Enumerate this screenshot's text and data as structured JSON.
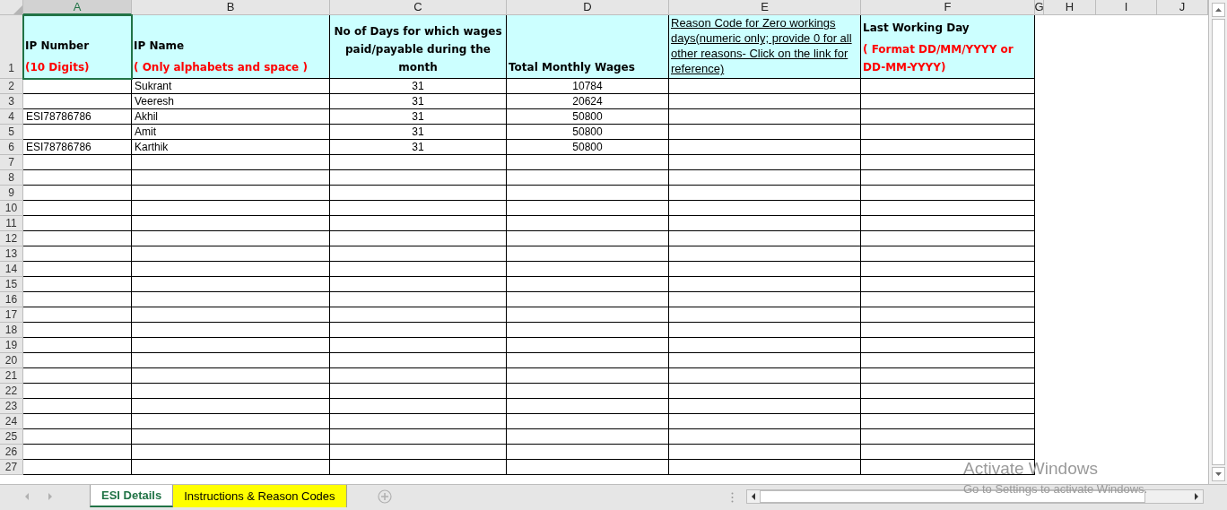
{
  "column_headers": [
    {
      "label": "A",
      "selected": true
    },
    {
      "label": "B",
      "selected": false
    },
    {
      "label": "C",
      "selected": false
    },
    {
      "label": "D",
      "selected": false
    },
    {
      "label": "E",
      "selected": false
    },
    {
      "label": "F",
      "selected": false
    },
    {
      "label": "G",
      "selected": false
    },
    {
      "label": "H",
      "selected": false
    },
    {
      "label": "I",
      "selected": false
    },
    {
      "label": "J",
      "selected": false
    }
  ],
  "row_numbers": [
    "1",
    "2",
    "3",
    "4",
    "5",
    "6",
    "7",
    "8",
    "9",
    "10",
    "11",
    "12",
    "13",
    "14",
    "15",
    "16",
    "17",
    "18",
    "19",
    "20",
    "21",
    "22",
    "23",
    "24",
    "25",
    "26",
    "27"
  ],
  "header_cells": [
    {
      "kind": "label",
      "title": "IP Number",
      "note": "(10 Digits)",
      "selected": true
    },
    {
      "kind": "label",
      "title": "IP Name",
      "note": "( Only alphabets and space )",
      "selected": false
    },
    {
      "kind": "label",
      "title": "No of Days for which wages paid/payable during the month",
      "selected": false
    },
    {
      "kind": "label",
      "title": "Total Monthly Wages",
      "selected": false
    },
    {
      "kind": "link",
      "title": " Reason Code for Zero workings days(numeric only; provide 0 for all other reasons- Click on the link for reference)",
      "selected": false
    },
    {
      "kind": "label",
      "title": "Last Working Day",
      "note": "( Format DD/MM/YYYY  or DD-MM-YYYY)",
      "selected": false
    }
  ],
  "rows": [
    {
      "ip_name": "Sukrant",
      "days": "31",
      "wages": "10784"
    },
    {
      "ip_name": "Veeresh",
      "days": "31",
      "wages": "20624"
    },
    {
      "ip_number": "ESI78786786",
      "ip_name": "Akhil",
      "days": "31",
      "wages": "50800"
    },
    {
      "ip_name": "Amit",
      "days": "31",
      "wages": "50800"
    },
    {
      "ip_number": "ESI78786786",
      "ip_name": "Karthik",
      "days": "31",
      "wages": "50800"
    }
  ],
  "sheet_tabs": [
    {
      "label": "ESI Details",
      "selected": true
    },
    {
      "label": "Instructions & Reason Codes",
      "selected": false,
      "color": "#ffff00"
    }
  ],
  "activation_notice": {
    "title": "Activate Windows",
    "subtitle": "Go to Settings to activate Windows."
  }
}
